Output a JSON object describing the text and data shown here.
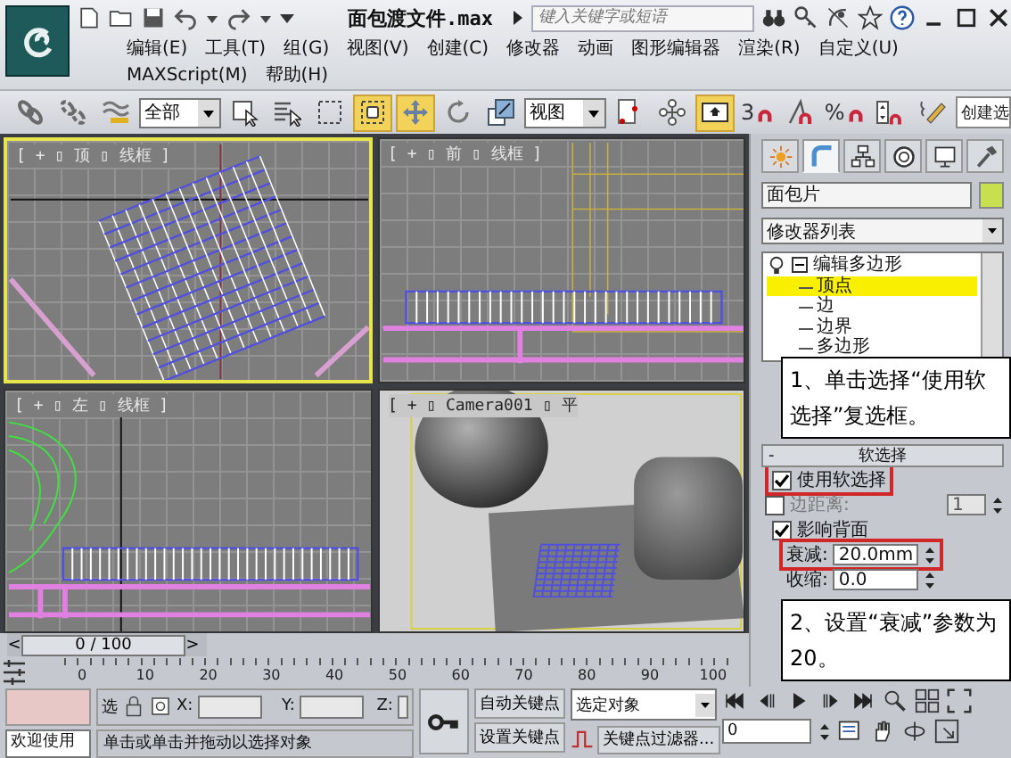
{
  "title_bar": {
    "title": "面包渡文件.max",
    "search": {
      "placeholder": "键入关键字或短语"
    }
  },
  "menu": [
    "编辑(E)",
    "工具(T)",
    "组(G)",
    "视图(V)",
    "创建(C)",
    "修改器",
    "动画",
    "图形编辑器",
    "渲染(R)",
    "自定义(U)",
    "MAXScript(M)",
    "帮助(H)"
  ],
  "toolbar": [
    {
      "kind": "link",
      "on": false
    },
    {
      "kind": "unlink",
      "on": false
    },
    {
      "kind": "bind",
      "on": false
    },
    {
      "kind": "dropdown",
      "value": "全部"
    },
    {
      "kind": "select",
      "on": false
    },
    {
      "kind": "select-by-name",
      "on": false
    },
    {
      "kind": "region",
      "on": false
    },
    {
      "kind": "crossing",
      "on": true
    },
    {
      "kind": "move",
      "on": true
    },
    {
      "kind": "rotate",
      "on": false
    },
    {
      "kind": "scale",
      "on": false
    },
    {
      "kind": "dropdown",
      "value": "视图"
    },
    {
      "kind": "pivot",
      "on": false
    },
    {
      "kind": "manipulate",
      "on": false
    },
    {
      "kind": "keyboard",
      "on": true
    },
    {
      "kind": "snap",
      "label": "3",
      "on": false
    },
    {
      "kind": "angle-snap",
      "on": false
    },
    {
      "kind": "snap",
      "label": "%",
      "on": false
    },
    {
      "kind": "spinner-snap",
      "on": false
    },
    {
      "kind": "named-sets",
      "on": false
    },
    {
      "kind": "field",
      "value": "创建选"
    }
  ],
  "viewports": [
    {
      "label": "[ + ▯ 顶 ▯ 线框 ]",
      "kind": "top",
      "active": true
    },
    {
      "label": "[ + ▯ 前 ▯ 线框 ]",
      "kind": "front",
      "active": false
    },
    {
      "label": "[ + ▯ 左 ▯ 线框 ]",
      "kind": "left",
      "active": false
    },
    {
      "label": "[ + ▯ Camera001 ▯ 平",
      "kind": "camera",
      "active": false
    }
  ],
  "command_panel": {
    "tabs": [
      {
        "kind": "create",
        "selected": false
      },
      {
        "kind": "modify",
        "selected": true
      },
      {
        "kind": "hierarchy",
        "selected": false
      },
      {
        "kind": "motion",
        "selected": false
      },
      {
        "kind": "display",
        "selected": false
      },
      {
        "kind": "utilities",
        "selected": false
      }
    ],
    "object_name": "面包片",
    "modifier_list": "修改器列表",
    "stack": [
      {
        "label": "编辑多边形",
        "expanded": true,
        "children": [
          {
            "label": "顶点",
            "selected": true
          },
          {
            "label": "边",
            "selected": false
          },
          {
            "label": "边界",
            "selected": false
          },
          {
            "label": "多边形",
            "selected": false
          }
        ]
      }
    ],
    "rollout": {
      "collapse_sign": "-",
      "title": "软选择",
      "rows": [
        {
          "kind": "checkbox",
          "label": "使用软选择",
          "checked": true,
          "highlighted": true
        },
        {
          "kind": "checkbox-spinner",
          "label": "边距离:",
          "checked": false,
          "value": "1",
          "disabled": true
        },
        {
          "kind": "checkbox",
          "label": "影响背面",
          "checked": true,
          "highlighted": false
        },
        {
          "kind": "spinner",
          "label": "衰减:",
          "value": "20.0mm",
          "highlighted": true
        },
        {
          "kind": "spinner",
          "label": "收缩:",
          "value": "0.0",
          "highlighted": false
        }
      ]
    }
  },
  "callouts": [
    "1、单击选择“使用软选择”复选框。",
    "2、设置“衰减”参数为 20。"
  ],
  "time_slider": {
    "prev": "<",
    "label": "0 / 100",
    "next": ">"
  },
  "track_bar": [
    "0",
    "10",
    "20",
    "30",
    "40",
    "50",
    "60",
    "70",
    "80",
    "90",
    "100"
  ],
  "status_bar": {
    "welcome": "欢迎使用",
    "selection_lock": "选",
    "x_label": "X:",
    "y_label": "Y:",
    "z_label": "Z:",
    "prompt": "单击或单击并拖动以选择对象",
    "auto_key": "自动关键点",
    "set_key": "设置关键点",
    "key_mode": "选定对象",
    "key_filters": "关键点过滤器...",
    "frame": "0"
  }
}
